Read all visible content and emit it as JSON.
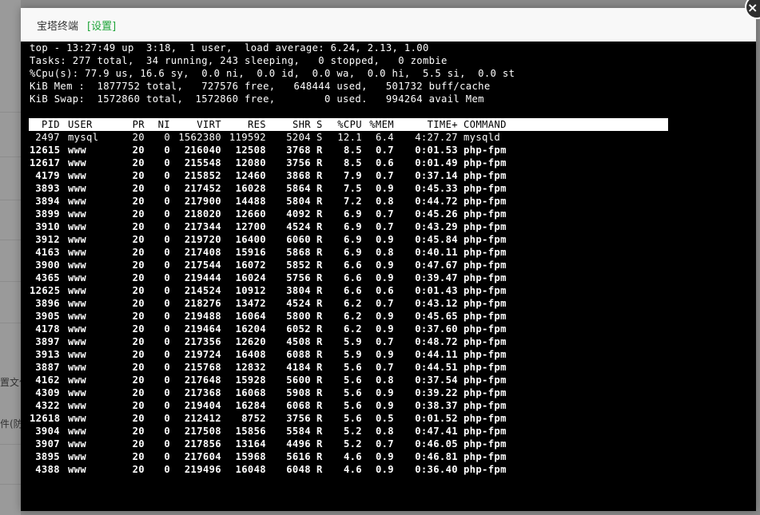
{
  "dialog": {
    "title": "宝塔终端",
    "settings_label": "[设置]",
    "close_label": "×"
  },
  "background": {
    "fragment_1": "置文件",
    "fragment_2": "件(防"
  },
  "terminal": {
    "summary": [
      "top - 13:27:49 up  3:18,  1 user,  load average: 6.24, 2.13, 1.00",
      "Tasks: 277 total,  34 running, 243 sleeping,   0 stopped,   0 zombie",
      "%Cpu(s): 77.9 us, 16.6 sy,  0.0 ni,  0.0 id,  0.0 wa,  0.0 hi,  5.5 si,  0.0 st",
      "KiB Mem :  1877752 total,   727576 free,   648444 used,   501732 buff/cache",
      "KiB Swap:  1572860 total,  1572860 free,        0 used.   994264 avail Mem"
    ],
    "columns": [
      "PID",
      "USER",
      "PR",
      "NI",
      "VIRT",
      "RES",
      "SHR",
      "S",
      "%CPU",
      "%MEM",
      "TIME+",
      "COMMAND"
    ],
    "processes": [
      [
        "2497",
        "mysql",
        "20",
        "0",
        "1562380",
        "119592",
        "5204",
        "S",
        "12.1",
        "6.4",
        "4:27.27",
        "mysqld"
      ],
      [
        "12615",
        "www",
        "20",
        "0",
        "216040",
        "12508",
        "3768",
        "R",
        "8.5",
        "0.7",
        "0:01.53",
        "php-fpm"
      ],
      [
        "12617",
        "www",
        "20",
        "0",
        "215548",
        "12080",
        "3756",
        "R",
        "8.5",
        "0.6",
        "0:01.49",
        "php-fpm"
      ],
      [
        "4179",
        "www",
        "20",
        "0",
        "215852",
        "12460",
        "3868",
        "R",
        "7.9",
        "0.7",
        "0:37.14",
        "php-fpm"
      ],
      [
        "3893",
        "www",
        "20",
        "0",
        "217452",
        "16028",
        "5864",
        "R",
        "7.5",
        "0.9",
        "0:45.33",
        "php-fpm"
      ],
      [
        "3894",
        "www",
        "20",
        "0",
        "217900",
        "14488",
        "5804",
        "R",
        "7.2",
        "0.8",
        "0:44.72",
        "php-fpm"
      ],
      [
        "3899",
        "www",
        "20",
        "0",
        "218020",
        "12660",
        "4092",
        "R",
        "6.9",
        "0.7",
        "0:45.26",
        "php-fpm"
      ],
      [
        "3910",
        "www",
        "20",
        "0",
        "217344",
        "12700",
        "4524",
        "R",
        "6.9",
        "0.7",
        "0:43.29",
        "php-fpm"
      ],
      [
        "3912",
        "www",
        "20",
        "0",
        "219720",
        "16400",
        "6060",
        "R",
        "6.9",
        "0.9",
        "0:45.84",
        "php-fpm"
      ],
      [
        "4163",
        "www",
        "20",
        "0",
        "217408",
        "15916",
        "5868",
        "R",
        "6.9",
        "0.8",
        "0:40.11",
        "php-fpm"
      ],
      [
        "3900",
        "www",
        "20",
        "0",
        "217544",
        "16072",
        "5852",
        "R",
        "6.6",
        "0.9",
        "0:47.67",
        "php-fpm"
      ],
      [
        "4365",
        "www",
        "20",
        "0",
        "219444",
        "16024",
        "5756",
        "R",
        "6.6",
        "0.9",
        "0:39.47",
        "php-fpm"
      ],
      [
        "12625",
        "www",
        "20",
        "0",
        "214524",
        "10912",
        "3804",
        "R",
        "6.6",
        "0.6",
        "0:01.43",
        "php-fpm"
      ],
      [
        "3896",
        "www",
        "20",
        "0",
        "218276",
        "13472",
        "4524",
        "R",
        "6.2",
        "0.7",
        "0:43.12",
        "php-fpm"
      ],
      [
        "3905",
        "www",
        "20",
        "0",
        "219488",
        "16064",
        "5800",
        "R",
        "6.2",
        "0.9",
        "0:45.65",
        "php-fpm"
      ],
      [
        "4178",
        "www",
        "20",
        "0",
        "219464",
        "16204",
        "6052",
        "R",
        "6.2",
        "0.9",
        "0:37.60",
        "php-fpm"
      ],
      [
        "3897",
        "www",
        "20",
        "0",
        "217356",
        "12620",
        "4508",
        "R",
        "5.9",
        "0.7",
        "0:48.72",
        "php-fpm"
      ],
      [
        "3913",
        "www",
        "20",
        "0",
        "219724",
        "16408",
        "6088",
        "R",
        "5.9",
        "0.9",
        "0:44.11",
        "php-fpm"
      ],
      [
        "3887",
        "www",
        "20",
        "0",
        "215768",
        "12832",
        "4184",
        "R",
        "5.6",
        "0.7",
        "0:44.51",
        "php-fpm"
      ],
      [
        "4162",
        "www",
        "20",
        "0",
        "217648",
        "15928",
        "5600",
        "R",
        "5.6",
        "0.8",
        "0:37.54",
        "php-fpm"
      ],
      [
        "4309",
        "www",
        "20",
        "0",
        "217368",
        "16068",
        "5908",
        "R",
        "5.6",
        "0.9",
        "0:39.22",
        "php-fpm"
      ],
      [
        "4322",
        "www",
        "20",
        "0",
        "219404",
        "16284",
        "6068",
        "R",
        "5.6",
        "0.9",
        "0:38.37",
        "php-fpm"
      ],
      [
        "12618",
        "www",
        "20",
        "0",
        "212412",
        "8752",
        "3756",
        "R",
        "5.6",
        "0.5",
        "0:01.52",
        "php-fpm"
      ],
      [
        "3904",
        "www",
        "20",
        "0",
        "217508",
        "15856",
        "5584",
        "R",
        "5.2",
        "0.8",
        "0:47.41",
        "php-fpm"
      ],
      [
        "3907",
        "www",
        "20",
        "0",
        "217856",
        "13164",
        "4496",
        "R",
        "5.2",
        "0.7",
        "0:46.05",
        "php-fpm"
      ],
      [
        "3895",
        "www",
        "20",
        "0",
        "217604",
        "15968",
        "5616",
        "R",
        "4.6",
        "0.9",
        "0:46.81",
        "php-fpm"
      ],
      [
        "4388",
        "www",
        "20",
        "0",
        "219496",
        "16048",
        "6048",
        "R",
        "4.6",
        "0.9",
        "0:36.40",
        "php-fpm"
      ]
    ]
  }
}
